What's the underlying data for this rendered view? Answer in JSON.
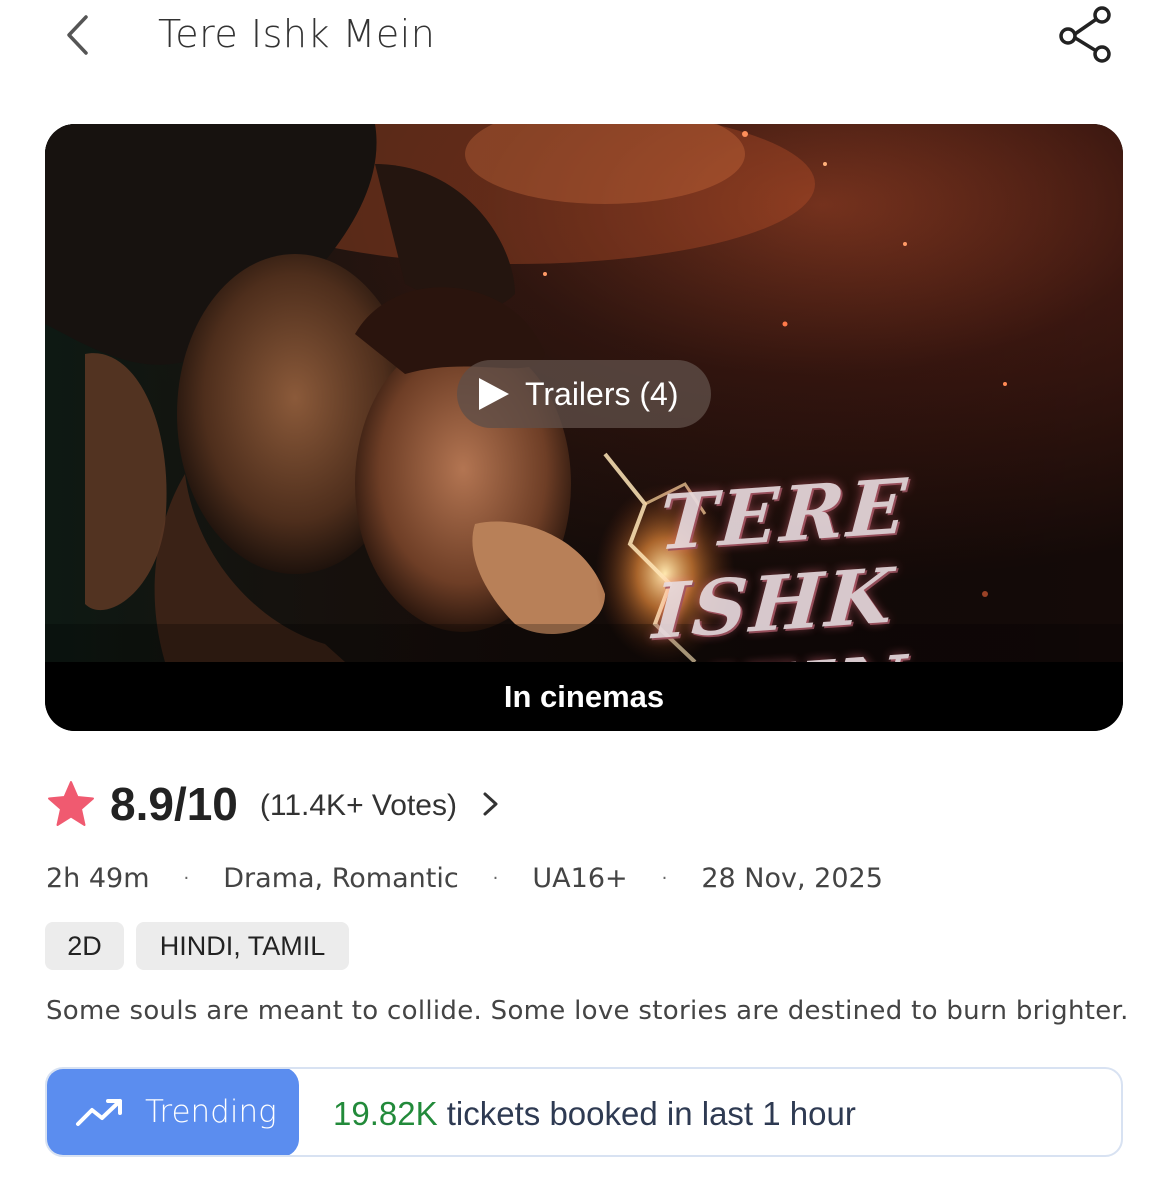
{
  "header": {
    "title": "Tere Ishk Mein",
    "back_icon": "chevron-left-icon",
    "share_icon": "share-icon"
  },
  "banner": {
    "poster_title": "TERE ISHK MEIN",
    "trailer_label": "Trailers (4)",
    "status_label": "In cinemas"
  },
  "rating": {
    "star_icon": "star-icon",
    "star_color": "#f05a70",
    "score": "8.9/10",
    "votes": "(11.4K+ Votes)"
  },
  "meta": {
    "duration": "2h 49m",
    "genres": "Drama, Romantic",
    "certificate": "UA16+",
    "release_date": "28 Nov, 2025"
  },
  "tags": {
    "format": "2D",
    "languages": "HINDI, TAMIL"
  },
  "tagline": "Some souls are meant to collide. Some love stories are destined to burn brighter.",
  "trending": {
    "label": "Trending",
    "icon": "trending-up-icon",
    "count": "19.82K",
    "text": " tickets booked in last 1 hour",
    "badge_color": "#5b8def",
    "count_color": "#228a3a"
  }
}
